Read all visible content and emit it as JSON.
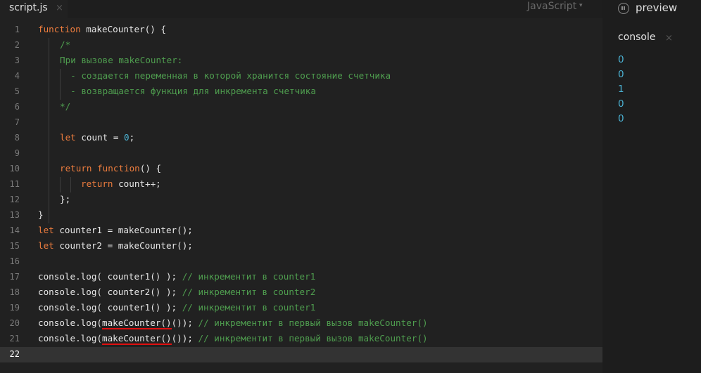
{
  "editor": {
    "tab_label": "script.js",
    "tab_close": "×",
    "language": "JavaScript",
    "language_caret": "▾",
    "active_line": 22,
    "lines": [
      {
        "n": "1"
      },
      {
        "n": "2"
      },
      {
        "n": "3"
      },
      {
        "n": "4"
      },
      {
        "n": "5"
      },
      {
        "n": "6"
      },
      {
        "n": "7"
      },
      {
        "n": "8"
      },
      {
        "n": "9"
      },
      {
        "n": "10"
      },
      {
        "n": "11"
      },
      {
        "n": "12"
      },
      {
        "n": "13"
      },
      {
        "n": "14"
      },
      {
        "n": "15"
      },
      {
        "n": "16"
      },
      {
        "n": "17"
      },
      {
        "n": "18"
      },
      {
        "n": "19"
      },
      {
        "n": "20"
      },
      {
        "n": "21"
      },
      {
        "n": "22"
      }
    ],
    "tokens": {
      "l1_kw": "function",
      "l1_rest": " makeCounter() {",
      "l2": "/*",
      "l3": "При вызове makeCounter:",
      "l4": "  - создается переменная в которой хранится состояние счетчика",
      "l5": "  - возвращается функция для инкремента счетчика",
      "l6": "*/",
      "l8_kw": "let",
      "l8_a": " count = ",
      "l8_num": "0",
      "l8_b": ";",
      "l10_kw1": "return",
      "l10_sp": " ",
      "l10_kw2": "function",
      "l10_rest": "() {",
      "l11_kw": "return",
      "l11_rest": " count++;",
      "l12": "};",
      "l13": "}",
      "l14_kw": "let",
      "l14_rest": " counter1 = makeCounter();",
      "l15_kw": "let",
      "l15_rest": " counter2 = makeCounter();",
      "l17_code": "console.log( counter1() ); ",
      "l17_cm": "// инкрементит в counter1",
      "l18_code": "console.log( counter2() ); ",
      "l18_cm": "// инкрементит в counter2",
      "l19_code": "console.log( counter1() ); ",
      "l19_cm": "// инкрементит в counter1",
      "l20_a": "console.log(",
      "l20_ul": "makeCounter()",
      "l20_b": "()); ",
      "l20_cm": "// инкрементит в первый вызов makeCounter()",
      "l21_a": "console.log(",
      "l21_ul": "makeCounter()",
      "l21_b": "()); ",
      "l21_cm": "// инкрементит в первый вызов makeCounter()"
    }
  },
  "preview": {
    "title": "preview",
    "console_tab": "console",
    "console_close": "×",
    "output": [
      "0",
      "0",
      "1",
      "0",
      "0"
    ]
  },
  "colors": {
    "keyword": "#ee7d3e",
    "number": "#4bb3d4",
    "comment": "#4f9e4f",
    "underline": "#e01010",
    "console_value": "#4bb3d4"
  },
  "icons": {
    "pause": "pause-circle-icon"
  }
}
